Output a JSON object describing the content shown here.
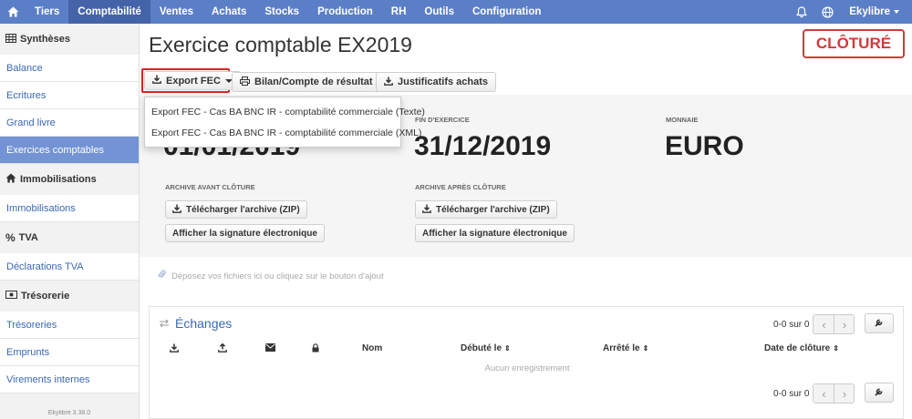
{
  "nav": {
    "items": [
      "Tiers",
      "Comptabilité",
      "Ventes",
      "Achats",
      "Stocks",
      "Production",
      "RH",
      "Outils",
      "Configuration"
    ],
    "active": "Comptabilité",
    "user": "Ekylibre",
    "icons": [
      "home-icon",
      "bell-icon",
      "globe-icon"
    ],
    "color": "#5b7fc7"
  },
  "sidebar": {
    "syntheses": {
      "heading": "Synthèses",
      "items": [
        "Balance",
        "Ecritures",
        "Grand livre",
        "Exercices comptables"
      ]
    },
    "immobilisations": {
      "heading": "Immobilisations",
      "items": [
        "Immobilisations"
      ]
    },
    "tva": {
      "heading": "TVA",
      "items": [
        "Déclarations TVA"
      ]
    },
    "tresorerie": {
      "heading": "Trésorerie",
      "items": [
        "Trésoreries",
        "Emprunts",
        "Virements internes"
      ]
    },
    "active_item": "Exercices comptables",
    "footer": "Ekylibre 3.38.0"
  },
  "page": {
    "title": "Exercice comptable EX2019",
    "status_stamp": "CLÔTURÉ",
    "status_color": "#d23a3a"
  },
  "toolbar": {
    "export_fec": "Export FEC",
    "bilan": "Bilan/Compte de résultat",
    "justificatifs": "Justificatifs achats"
  },
  "dropdown": {
    "items": [
      "Export FEC - Cas BA BNC IR - comptabilité commerciale (Texte)",
      "Export FEC - Cas BA BNC IR - comptabilité commerciale (XML)"
    ]
  },
  "exercise": {
    "start_value": "01/01/2019",
    "end_label": "Fin d'exercice",
    "end_value": "31/12/2019",
    "currency_label": "Monnaie",
    "currency_value": "EURO",
    "archive_before_label": "Archive avant clôture",
    "archive_after_label": "Archive après clôture",
    "download_zip": "Télécharger l'archive (ZIP)",
    "show_signature": "Afficher la signature électronique"
  },
  "dropzone": {
    "text": "Déposez vos fichiers ici ou cliquez sur le bouton d'ajout"
  },
  "exchanges": {
    "title": "Échanges",
    "pager_text": "0-0 sur 0",
    "columns": {
      "nom": "Nom",
      "debute": "Débuté le",
      "arrete": "Arrêté le",
      "cloture": "Date de clôture"
    },
    "empty": "Aucun enregistrement"
  }
}
